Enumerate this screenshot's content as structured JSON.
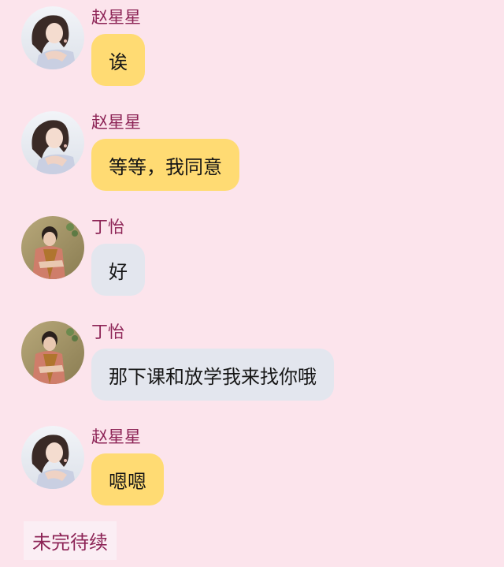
{
  "messages": [
    {
      "sender": "赵星星",
      "text": "诶",
      "avatar": "avatar-zhao-xingxing"
    },
    {
      "sender": "赵星星",
      "text": "等等，我同意",
      "avatar": "avatar-zhao-xingxing"
    },
    {
      "sender": "丁怡",
      "text": "好",
      "avatar": "avatar-ding-yi"
    },
    {
      "sender": "丁怡",
      "text": "那下课和放学我来找你哦",
      "avatar": "avatar-ding-yi"
    },
    {
      "sender": "赵星星",
      "text": "嗯嗯",
      "avatar": "avatar-zhao-xingxing"
    }
  ],
  "footer": {
    "label": "未完待续"
  },
  "colors": {
    "background": "#fce4ec",
    "name": "#8d2456",
    "bubble_yellow": "#ffdb73",
    "bubble_grey": "#e3e6ee",
    "footer_bg": "#fbeef4"
  }
}
